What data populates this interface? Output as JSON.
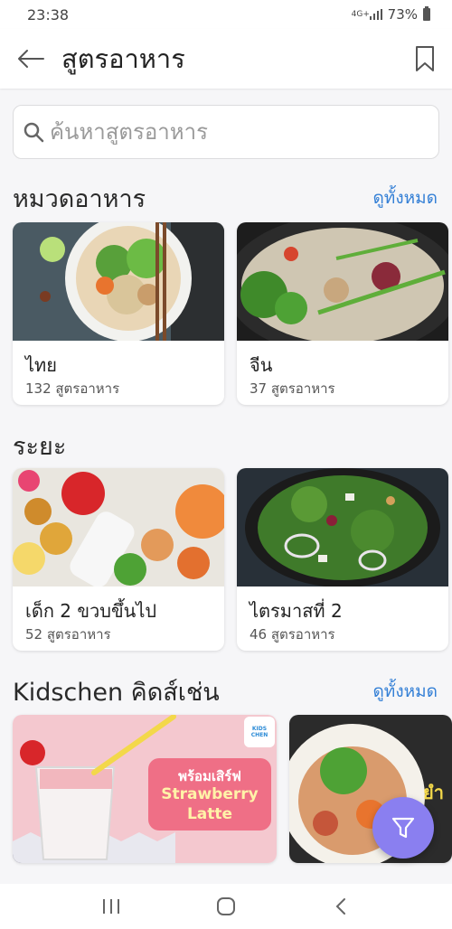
{
  "status_bar": {
    "time": "23:38",
    "network": "4G+",
    "battery": "73%"
  },
  "app_bar": {
    "title": "สูตรอาหาร"
  },
  "search": {
    "placeholder": "ค้นหาสูตรอาหาร"
  },
  "categories": {
    "title": "หมวดอาหาร",
    "see_all": "ดูทั้งหมด",
    "items": [
      {
        "title": "ไทย",
        "count": "132 สูตรอาหาร"
      },
      {
        "title": "จีน",
        "count": "37 สูตรอาหาร"
      }
    ]
  },
  "stages": {
    "title": "ระยะ",
    "items": [
      {
        "title": "เด็ก 2 ขวบขึ้นไป",
        "count": "52 สูตรอาหาร"
      },
      {
        "title": "ไตรมาสที่ 2",
        "count": "46 สูตรอาหาร"
      }
    ]
  },
  "kidschen": {
    "title": "Kidschen คิดส์เช่น",
    "see_all": "ดูทั้งหมด",
    "promo1": {
      "line1": "พร้อมเสิร์ฟ",
      "line2": "Strawberry",
      "line3": "Latte",
      "logo": "KIDS CHEN"
    },
    "promo2": {
      "label": "ยำ"
    }
  },
  "icons": {
    "back": "arrow-left-icon",
    "bookmark": "bookmark-icon",
    "search": "search-icon",
    "filter": "filter-icon"
  },
  "colors": {
    "accent": "#3580d6",
    "fab": "#8a7ff0",
    "promo_bg": "#f4c8cf",
    "promo_pill": "#ef6f86"
  }
}
